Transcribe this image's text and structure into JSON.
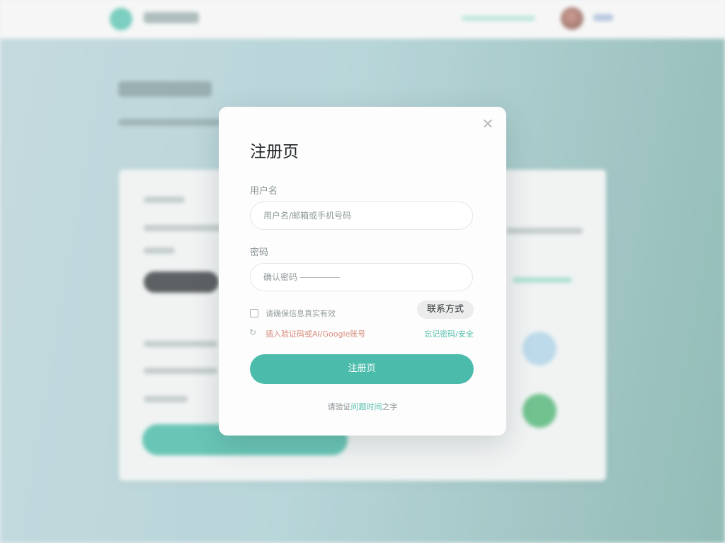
{
  "modal": {
    "title": "注册页",
    "close_icon": "close-icon",
    "username": {
      "label": "用户名",
      "placeholder": "用户名/邮箱或手机号码"
    },
    "password": {
      "label": "密码",
      "placeholder": "确认密码"
    },
    "terms_checkbox_label": "请确保信息真实有效",
    "contact_button": "联系方式",
    "captcha_hint": "插入验证码或AI/Google账号",
    "forgot_link": "忘记密码/安全",
    "submit_button": "注册页",
    "footer": {
      "prefix": "请验证",
      "link": "问题时间",
      "suffix": "之字"
    }
  },
  "colors": {
    "accent": "#4bbcab",
    "link": "#54bfae",
    "warning_text": "#d78b7c"
  }
}
